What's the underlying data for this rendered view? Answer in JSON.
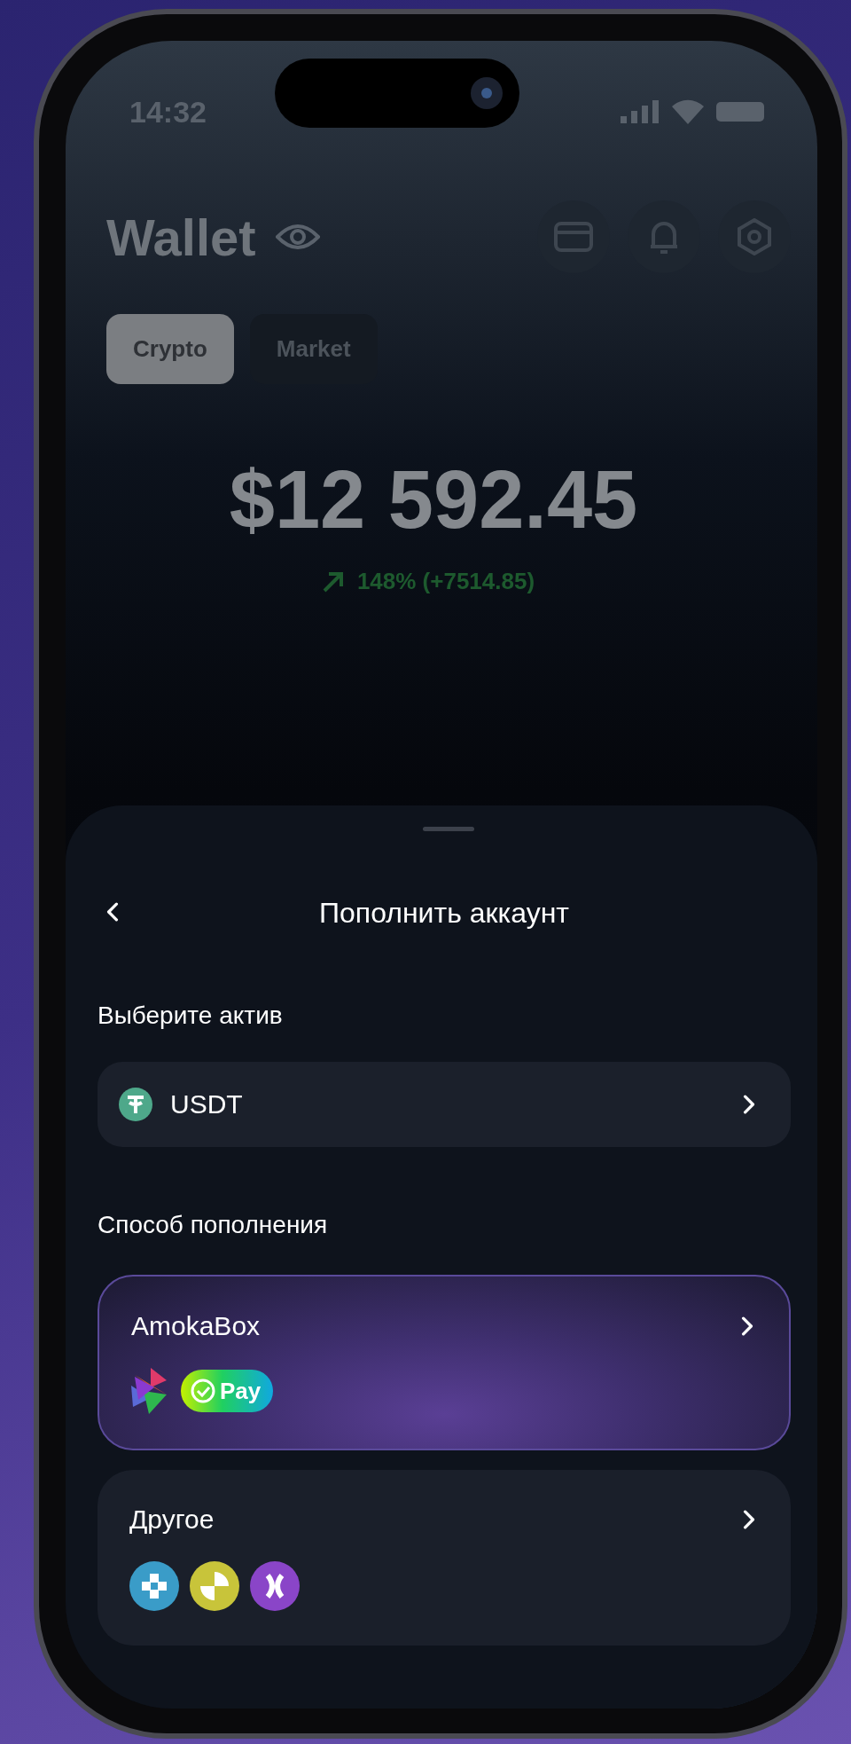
{
  "status_bar": {
    "time": "14:32"
  },
  "header": {
    "title": "Wallet"
  },
  "tabs": [
    {
      "label": "Crypto",
      "selected": true
    },
    {
      "label": "Market",
      "selected": false
    }
  ],
  "balance": {
    "amount": "$12 592.45",
    "change": "148% (+7514.85)"
  },
  "sheet": {
    "title": "Пополнить аккаунт",
    "asset_label": "Выберите актив",
    "asset": {
      "name": "USDT"
    },
    "method_label": "Способ пополнения",
    "methods": [
      {
        "kind": "featured",
        "name": "AmokaBox",
        "badge": "Pay"
      },
      {
        "kind": "plain",
        "name": "Другое"
      }
    ]
  }
}
